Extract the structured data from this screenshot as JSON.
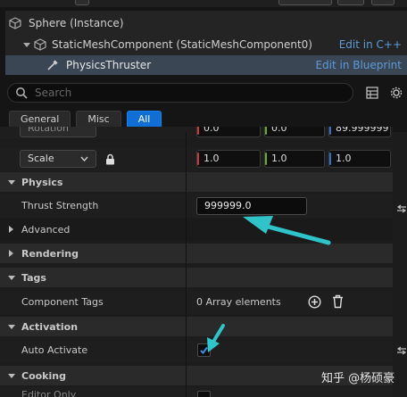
{
  "tree": {
    "root": "Sphere (Instance)",
    "component": "StaticMeshComponent (StaticMeshComponent0)",
    "component_link": "Edit in C++",
    "selected": "PhysicsThruster",
    "selected_link": "Edit in Blueprint"
  },
  "search": {
    "placeholder": "Search"
  },
  "tabs": [
    "General",
    "Misc",
    "All"
  ],
  "active_tab": "All",
  "transform": {
    "rotation_label": "Rotation",
    "rotation_values": [
      "0.0",
      "0.0",
      "89.999999"
    ],
    "scale_label": "Scale",
    "scale_values": [
      "1.0",
      "1.0",
      "1.0"
    ]
  },
  "physics": {
    "category": "Physics",
    "thrust_label": "Thrust Strength",
    "thrust_value": "999999.0"
  },
  "categories": {
    "advanced": "Advanced",
    "rendering": "Rendering",
    "tags": "Tags",
    "activation": "Activation",
    "cooking": "Cooking"
  },
  "tags": {
    "component_tags_label": "Component Tags",
    "array_text": "0 Array elements"
  },
  "activation": {
    "auto_activate_label": "Auto Activate",
    "auto_activate_checked": true
  },
  "cooking_partial": "Editor Only",
  "watermark": "知乎 @杨硕豪",
  "colors": {
    "accent": "#0f6fd6",
    "link": "#5e9ad8",
    "annotation_arrow": "#2ec4c9"
  }
}
